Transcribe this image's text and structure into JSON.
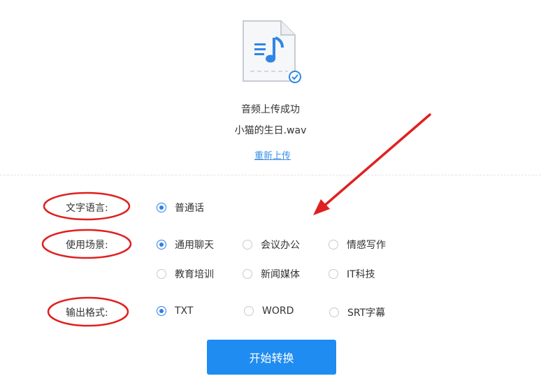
{
  "upload": {
    "status_text": "音频上传成功",
    "file_name": "小猫的生日.wav",
    "reupload_link": "重新上传"
  },
  "form": {
    "language": {
      "label": "文字语言:",
      "options": [
        {
          "label": "普通话",
          "selected": true
        }
      ]
    },
    "scene": {
      "label": "使用场景:",
      "options": [
        {
          "label": "通用聊天",
          "selected": true
        },
        {
          "label": "会议办公",
          "selected": false
        },
        {
          "label": "情感写作",
          "selected": false
        },
        {
          "label": "教育培训",
          "selected": false
        },
        {
          "label": "新闻媒体",
          "selected": false
        },
        {
          "label": "IT科技",
          "selected": false
        }
      ]
    },
    "format": {
      "label": "输出格式:",
      "options": [
        {
          "label": "TXT",
          "selected": true
        },
        {
          "label": "WORD",
          "selected": false
        },
        {
          "label": "SRT字幕",
          "selected": false
        }
      ]
    }
  },
  "start_button": "开始转换",
  "colors": {
    "accent": "#1e8cf0",
    "link": "#3a8ee6",
    "annotation_red": "#e02020"
  }
}
